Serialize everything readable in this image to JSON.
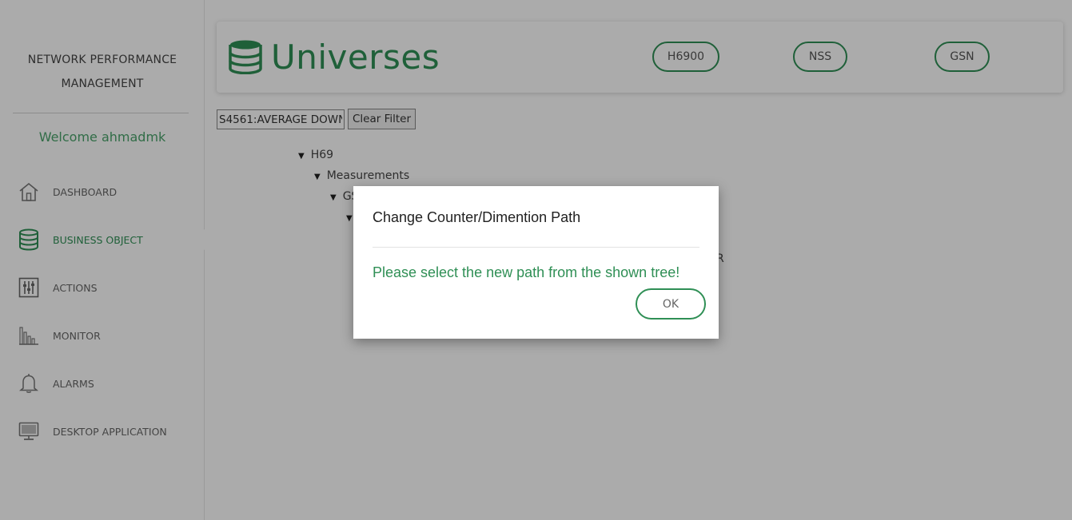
{
  "sidebar": {
    "brand_line1": "NETWORK PERFORMANCE",
    "brand_line2": "MANAGEMENT",
    "welcome": "Welcome ahmadmk",
    "items": [
      {
        "label": "DASHBOARD",
        "icon": "home-icon"
      },
      {
        "label": "BUSINESS OBJECT",
        "icon": "database-icon",
        "active": true
      },
      {
        "label": "ACTIONS",
        "icon": "sliders-icon"
      },
      {
        "label": "MONITOR",
        "icon": "bar-chart-icon"
      },
      {
        "label": "ALARMS",
        "icon": "bell-icon"
      },
      {
        "label": "DESKTOP APPLICATION",
        "icon": "monitor-icon"
      }
    ]
  },
  "header": {
    "title": "Universes",
    "pills": [
      "H6900",
      "NSS",
      "GSN"
    ]
  },
  "filter": {
    "value": "S4561:AVERAGE DOWN",
    "clear_label": "Clear Filter"
  },
  "tree": {
    "row1": "H69",
    "row2": "Measurements",
    "row3": "GS",
    "row5_fragment": "R"
  },
  "modal": {
    "title": "Change Counter/Dimention Path",
    "message": "Please select the new path from the shown tree!",
    "ok_label": "OK"
  },
  "colors": {
    "accent": "#2f8f55",
    "overlay": "rgba(0,0,0,0.33)"
  }
}
